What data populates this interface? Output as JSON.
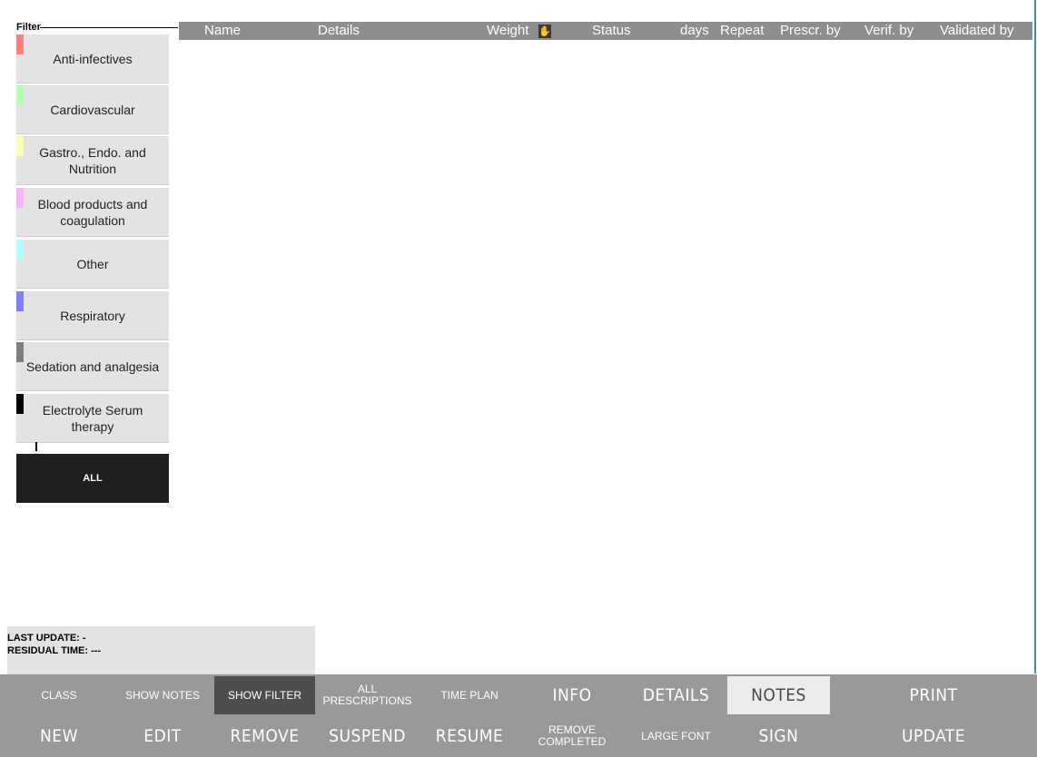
{
  "filter": {
    "label": "Filter",
    "items": [
      {
        "label": "Anti-infectives",
        "color": "#ff7f7f"
      },
      {
        "label": "Cardiovascular",
        "color": "#b3ffb3"
      },
      {
        "label": "Gastro., Endo. and Nutrition",
        "color": "#ffffb3"
      },
      {
        "label": "Blood products and coagulation",
        "color": "#ffb3ff"
      },
      {
        "label": "Other",
        "color": "#b3ffff"
      },
      {
        "label": "Respiratory",
        "color": "#8080ff"
      },
      {
        "label": "Sedation and analgesia",
        "color": "#7f7f7f"
      },
      {
        "label": "Electrolyte Serum therapy",
        "color": "#000000"
      }
    ],
    "all_label": "ALL"
  },
  "table": {
    "columns": {
      "name": "Name",
      "details": "Details",
      "weight": "Weight",
      "status": "Status",
      "days": "days",
      "repeat": "Repeat",
      "prescr_by": "Prescr. by",
      "verif_by": "Verif. by",
      "validated_by": "Validated by"
    },
    "header_icons": [
      "exclamation-icon",
      "sort-arrows-icon",
      "hand-icon"
    ]
  },
  "status": {
    "last_update": "LAST UPDATE:  -",
    "residual_time": "RESIDUAL TIME:  ---"
  },
  "toolbar": {
    "row1": {
      "class": "CLASS",
      "show_notes": "SHOW NOTES",
      "show_filter": "SHOW FILTER",
      "all_prescriptions": "ALL PRESCRIPTIONS",
      "time_plan": "TIME PLAN",
      "info": "INFO",
      "details": "DETAILS",
      "notes": "NOTES",
      "print": "PRINT"
    },
    "row2": {
      "new": "NEW",
      "edit": "EDIT",
      "remove": "REMOVE",
      "suspend": "SUSPEND",
      "resume": "RESUME",
      "remove_completed": "REMOVE COMPLETED",
      "large_font": "LARGE FONT",
      "sign": "SIGN",
      "update": "UPDATE"
    }
  }
}
